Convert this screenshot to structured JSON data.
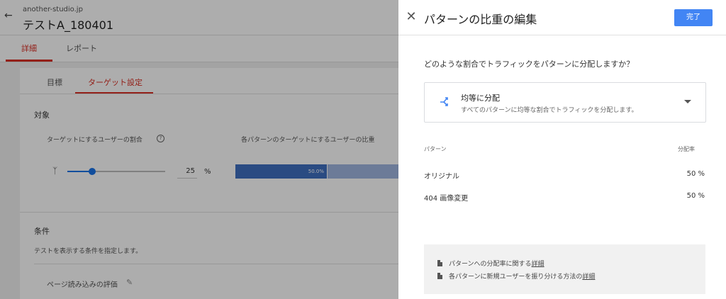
{
  "header": {
    "site_name": "another-studio.jp",
    "experiment_name": "テストA_180401",
    "back_icon": "arrow-left-icon"
  },
  "main_tabs": [
    {
      "label": "詳細",
      "active": true
    },
    {
      "label": "レポート",
      "active": false
    }
  ],
  "sub_tabs": [
    {
      "label": "目標",
      "active": false
    },
    {
      "label": "ターゲット設定",
      "active": true
    }
  ],
  "targeting": {
    "section_title": "対象",
    "users_ratio_label": "ターゲットにするユーザーの割合",
    "users_ratio_value": "25",
    "users_ratio_unit": "%",
    "variant_weight_label": "各パターンのターゲットにするユーザーの比重",
    "weight_bar_label": "50.0%",
    "weight_fraction": 0.5
  },
  "conditions": {
    "section_title": "条件",
    "description": "テストを表示する条件を指定します。",
    "page_load_label": "ページ読み込みの評価"
  },
  "panel": {
    "title": "パターンの比重の編集",
    "done_label": "完了",
    "question": "どのような割合でトラフィックをパターンに分配しますか？",
    "distribution": {
      "title": "均等に分配",
      "description": "すべてのパターンに均等な割合でトラフィックを分配します。",
      "icon": "shuffle-icon"
    },
    "table": {
      "col_variant": "パターン",
      "col_ratio": "分配率",
      "rows": [
        {
          "name": "オリジナル",
          "ratio": "50 %"
        },
        {
          "name": "404 画像変更",
          "ratio": "50 %"
        }
      ]
    },
    "help": {
      "line1_text": "パターンへの分配率に関する",
      "line1_link": "詳細",
      "line2_text": "各パターンに新規ユーザーを振り分ける方法の",
      "line2_link": "詳細"
    }
  },
  "colors": {
    "accent_red": "#d93025",
    "primary_blue": "#4285f4",
    "bar_blue": "#3f6fc0"
  }
}
